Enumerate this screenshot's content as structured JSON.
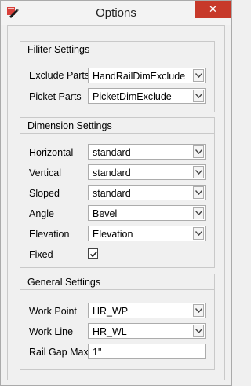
{
  "window": {
    "title": "Options",
    "close_symbol": "✕"
  },
  "icons": {
    "app": "app-icon",
    "close": "close-icon",
    "dropdown": "chevron-down-icon",
    "check": "check-icon"
  },
  "colors": {
    "close_button": "#c7392a",
    "border": "#c9c9c9",
    "background": "#f0f0f0"
  },
  "filter_settings": {
    "title": "Filiter Settings",
    "exclude_parts": {
      "label": "Exclude Parts",
      "value": "HandRailDimExclude"
    },
    "picket_parts": {
      "label": "Picket Parts",
      "value": "PicketDimExclude"
    }
  },
  "dimension_settings": {
    "title": "Dimension Settings",
    "horizontal": {
      "label": "Horizontal",
      "value": "standard"
    },
    "vertical": {
      "label": "Vertical",
      "value": "standard"
    },
    "sloped": {
      "label": "Sloped",
      "value": "standard"
    },
    "angle": {
      "label": "Angle",
      "value": "Bevel"
    },
    "elevation": {
      "label": "Elevation",
      "value": "Elevation"
    },
    "fixed": {
      "label": "Fixed",
      "checked": true
    }
  },
  "general_settings": {
    "title": "General Settings",
    "work_point": {
      "label": "Work Point",
      "value": "HR_WP"
    },
    "work_line": {
      "label": "Work Line",
      "value": "HR_WL"
    },
    "rail_gap_max": {
      "label": "Rail Gap Max",
      "value": "1\""
    }
  }
}
